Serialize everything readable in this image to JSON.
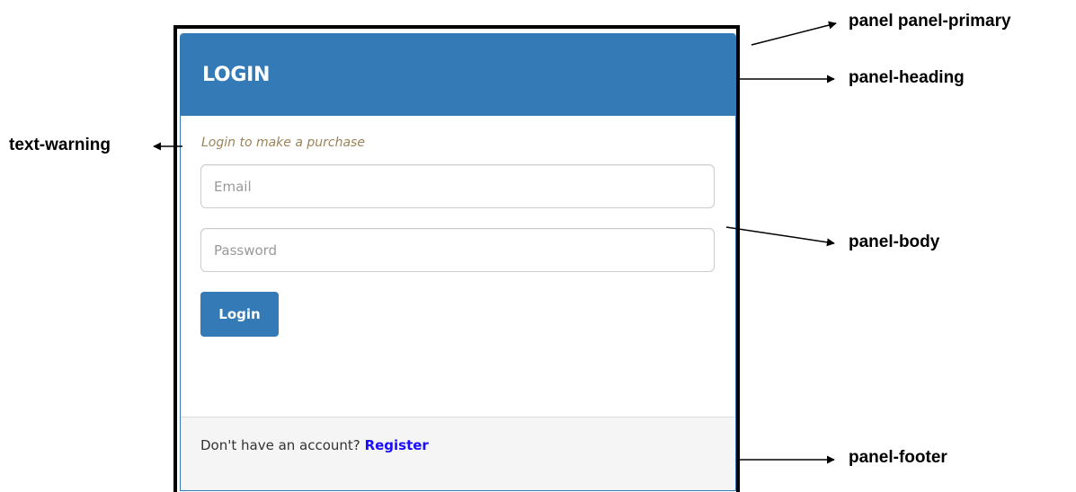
{
  "panel": {
    "heading": "LOGIN",
    "warning": "Login to make a purchase",
    "email_placeholder": "Email",
    "password_placeholder": "Password",
    "button_label": "Login",
    "footer_text": "Don't have an account?",
    "footer_link": "Register"
  },
  "annotations": {
    "panel_primary": "panel panel-primary",
    "panel_heading": "panel-heading",
    "text_warning": "text-warning",
    "panel_body": "panel-body",
    "panel_footer": "panel-footer"
  },
  "colors": {
    "primary": "#337ab7",
    "warning": "#8a6d3b",
    "link": "#1a0dff",
    "footer_bg": "#f5f5f5"
  }
}
